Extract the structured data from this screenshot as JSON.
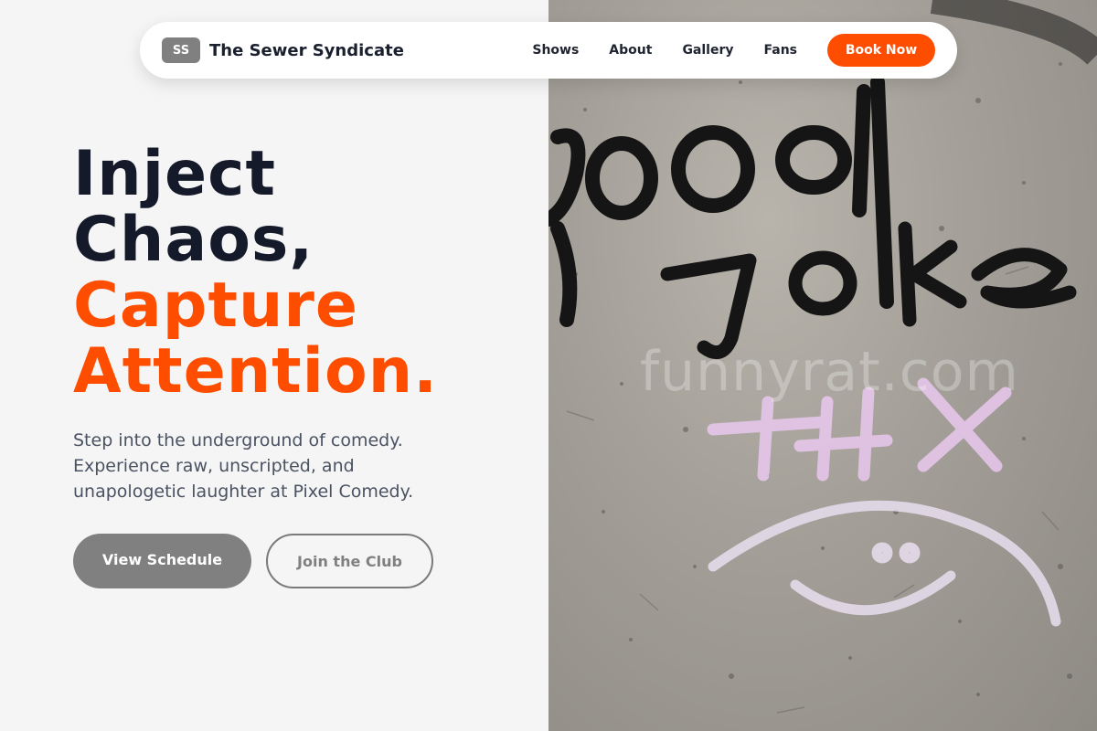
{
  "nav": {
    "logo_initials": "SS",
    "brand": "The Sewer Syndicate",
    "links": [
      "Shows",
      "About",
      "Gallery",
      "Fans"
    ],
    "cta": "Book Now"
  },
  "hero": {
    "headline_line1": "Inject",
    "headline_line2": "Chaos,",
    "headline_line3": "Capture",
    "headline_line4": "Attention.",
    "subtext": "Step into the underground of comedy. Experience raw, unscripted, and unapologetic laughter at Pixel Comedy.",
    "primary_button": "View Schedule",
    "secondary_button": "Join the Club"
  },
  "photo": {
    "graffiti_text": "good joke",
    "watermark": "funnyrat.com"
  },
  "colors": {
    "accent": "#ff4d00",
    "headline_dark": "#141a2a",
    "button_gray": "#808080",
    "background": "#f5f5f5"
  }
}
